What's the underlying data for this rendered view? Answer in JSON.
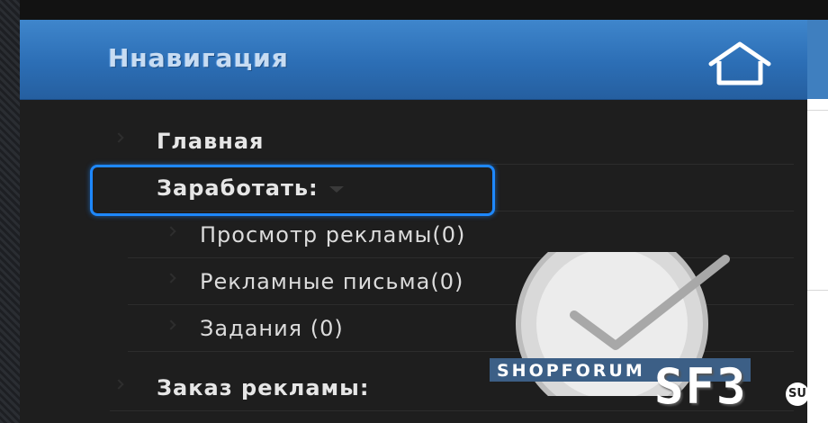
{
  "header": {
    "title": "Ннавигация",
    "home_icon": "home-icon"
  },
  "nav": [
    {
      "label": "Главная",
      "level": 0
    },
    {
      "label": "Заработать:",
      "level": 0,
      "dropdown": true,
      "highlighted": true
    },
    {
      "label": "Просмотр рекламы(0)",
      "level": 1
    },
    {
      "label": "Рекламные письма(0)",
      "level": 1
    },
    {
      "label": "Задания (0)",
      "level": 1
    },
    {
      "label": "Заказ рекламы:",
      "level": 0
    }
  ],
  "watermark": {
    "logo_text": "SHOPFORUM",
    "brand": "SF3",
    "suffix": "SU"
  },
  "colors": {
    "header_blue": "#2c6eb5",
    "highlight": "#1e88ff",
    "panel": "#1e1e1e"
  }
}
